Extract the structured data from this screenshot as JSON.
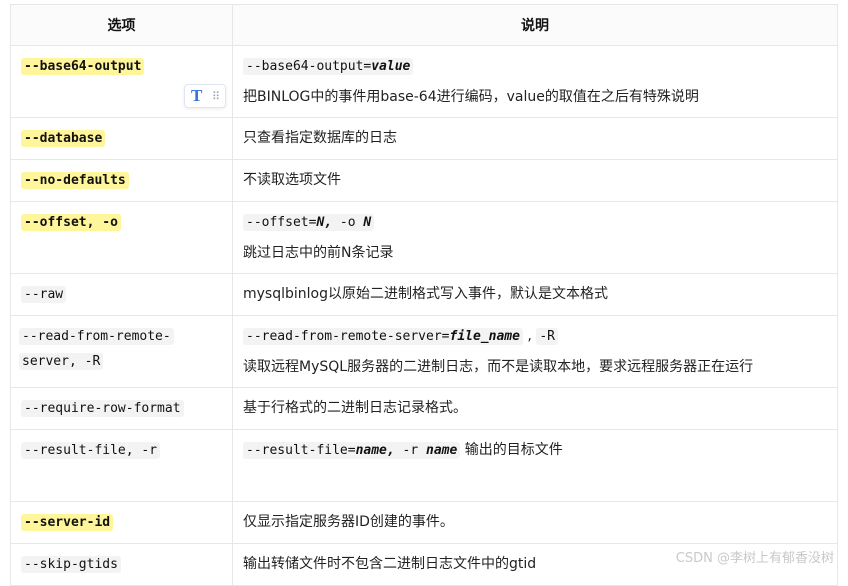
{
  "header": {
    "col1": "选项",
    "col2": "说明"
  },
  "rows": [
    {
      "opt": "--base64-output",
      "hl": true,
      "code": "--base64-output=",
      "code_it": "value",
      "desc": "把BINLOG中的事件用base-64进行编码，value的取值在之后有特殊说明"
    },
    {
      "opt": "--database",
      "hl": true,
      "desc": "只查看指定数据库的日志"
    },
    {
      "opt": "--no-defaults",
      "hl": true,
      "desc": "不读取选项文件"
    },
    {
      "opt": "--offset, -o",
      "hl": true,
      "code": "--offset=",
      "code_it": "N,",
      "code_tail": " -o ",
      "code_it2": "N",
      "desc": "跳过日志中的前N条记录"
    },
    {
      "opt": "--raw",
      "hl": false,
      "desc": "mysqlbinlog以原始二进制格式写入事件，默认是文本格式"
    },
    {
      "opt_line1": "--read-from-remote-",
      "opt_line2": "server, -R",
      "hl": false,
      "code": "--read-from-remote-server=",
      "code_it": "file_name",
      "code_sep": " , ",
      "code_tail": "-R",
      "desc": "读取远程MySQL服务器的二进制日志，而不是读取本地，要求远程服务器正在运行"
    },
    {
      "opt": "--require-row-format",
      "hl": false,
      "desc": "基于行格式的二进制日志记录格式。"
    },
    {
      "opt": "--result-file, -r",
      "hl": false,
      "code": "--result-file=",
      "code_it": "name,",
      "code_tail": " -r ",
      "code_it2": "name",
      "desc_inline": " 输出的目标文件"
    },
    {
      "opt": "--server-id",
      "hl": true,
      "desc": "仅显示指定服务器ID创建的事件。"
    },
    {
      "opt": "--skip-gtids",
      "hl": false,
      "desc": "输出转储文件时不包含二进制日志文件中的gtid"
    }
  ],
  "toolbar": {
    "text_icon": "T",
    "drag_icon": "⠿"
  },
  "watermark": "CSDN @李树上有郁香没树"
}
